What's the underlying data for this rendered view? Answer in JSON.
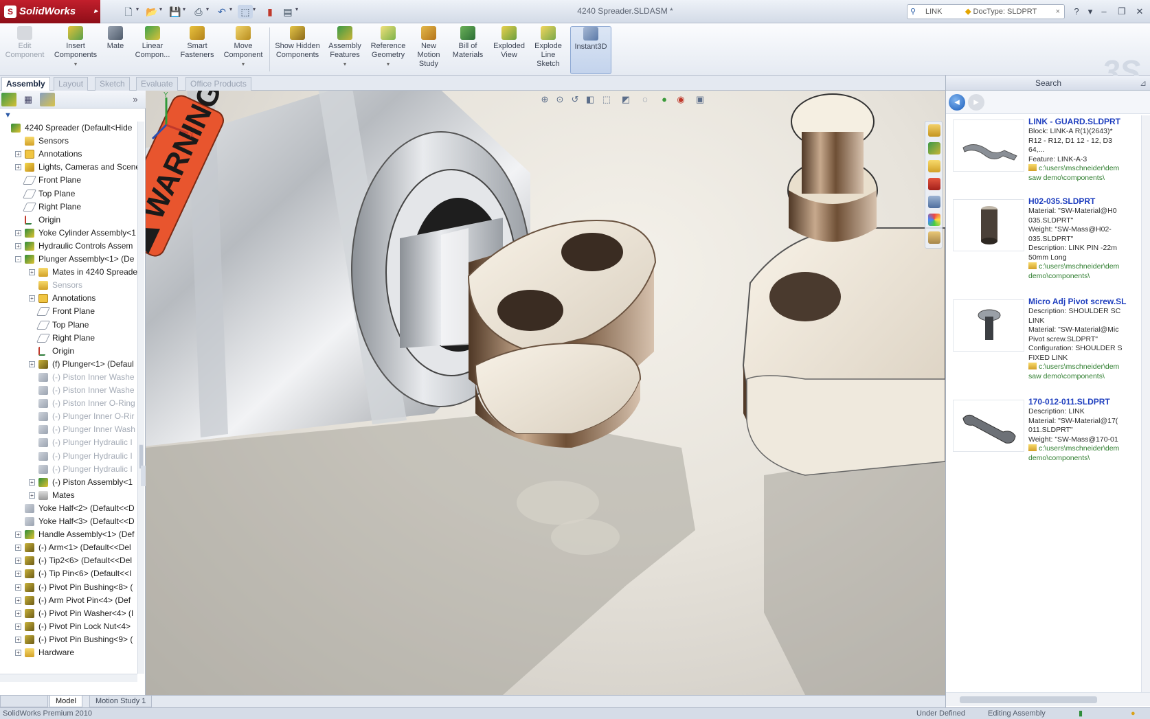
{
  "app": {
    "name": "SolidWorks",
    "document_title": "4240 Spreader.SLDASM *"
  },
  "search_box": {
    "term": "LINK",
    "filter": "DocType: SLDPRT"
  },
  "ribbon": [
    {
      "label": "Edit Component",
      "disabled": true
    },
    {
      "label": "Insert Components"
    },
    {
      "label": "Mate"
    },
    {
      "label": "Linear Compon..."
    },
    {
      "label": "Smart Fasteners"
    },
    {
      "label": "Move Component"
    },
    {
      "label": "Show Hidden Components"
    },
    {
      "label": "Assembly Features"
    },
    {
      "label": "Reference Geometry"
    },
    {
      "label": "New Motion Study"
    },
    {
      "label": "Bill of Materials"
    },
    {
      "label": "Exploded View"
    },
    {
      "label": "Explode Line Sketch"
    },
    {
      "label": "Instant3D",
      "active": true
    }
  ],
  "command_tabs": [
    "Assembly",
    "Layout",
    "Sketch",
    "Evaluate",
    "Office Products"
  ],
  "tree": [
    {
      "text": "4240 Spreader  (Default<Hide",
      "level": 0,
      "icon": "asm"
    },
    {
      "text": "Sensors",
      "level": 1,
      "icon": "folder"
    },
    {
      "text": "Annotations",
      "level": 1,
      "icon": "annot",
      "exp": "+"
    },
    {
      "text": "Lights, Cameras and Scene",
      "level": 1,
      "icon": "lights",
      "exp": "+"
    },
    {
      "text": "Front Plane",
      "level": 1,
      "icon": "plane"
    },
    {
      "text": "Top Plane",
      "level": 1,
      "icon": "plane"
    },
    {
      "text": "Right Plane",
      "level": 1,
      "icon": "plane"
    },
    {
      "text": "Origin",
      "level": 1,
      "icon": "origin"
    },
    {
      "text": "Yoke Cylinder Assembly<1",
      "level": 1,
      "icon": "asm",
      "exp": "+"
    },
    {
      "text": "Hydraulic Controls Assem",
      "level": 1,
      "icon": "asm",
      "exp": "+"
    },
    {
      "text": "Plunger Assembly<1> (De",
      "level": 1,
      "icon": "asm",
      "exp": "-"
    },
    {
      "text": "Mates in 4240 Spreade",
      "level": 2,
      "icon": "folder",
      "exp": "+"
    },
    {
      "text": "Sensors",
      "level": 2,
      "icon": "folder",
      "sup": true
    },
    {
      "text": "Annotations",
      "level": 2,
      "icon": "annot",
      "exp": "+"
    },
    {
      "text": "Front Plane",
      "level": 2,
      "icon": "plane"
    },
    {
      "text": "Top Plane",
      "level": 2,
      "icon": "plane"
    },
    {
      "text": "Right Plane",
      "level": 2,
      "icon": "plane"
    },
    {
      "text": "Origin",
      "level": 2,
      "icon": "origin"
    },
    {
      "text": "(f) Plunger<1> (Defaul",
      "level": 2,
      "icon": "part",
      "exp": "+"
    },
    {
      "text": "(-) Piston Inner Washe",
      "level": 2,
      "icon": "partg",
      "sup": true
    },
    {
      "text": "(-) Piston Inner Washe",
      "level": 2,
      "icon": "partg",
      "sup": true
    },
    {
      "text": "(-) Piston Inner O-Ring",
      "level": 2,
      "icon": "partg",
      "sup": true
    },
    {
      "text": "(-) Plunger Inner O-Rir",
      "level": 2,
      "icon": "partg",
      "sup": true
    },
    {
      "text": "(-) Plunger Inner Wash",
      "level": 2,
      "icon": "partg",
      "sup": true
    },
    {
      "text": "(-) Plunger Hydraulic I",
      "level": 2,
      "icon": "partg",
      "sup": true
    },
    {
      "text": "(-) Plunger Hydraulic I",
      "level": 2,
      "icon": "partg",
      "sup": true
    },
    {
      "text": "(-) Plunger Hydraulic I",
      "level": 2,
      "icon": "partg",
      "sup": true
    },
    {
      "text": "(-) Piston Assembly<1",
      "level": 2,
      "icon": "asm",
      "exp": "+"
    },
    {
      "text": "Mates",
      "level": 2,
      "icon": "mates",
      "exp": "+"
    },
    {
      "text": "Yoke Half<2> (Default<<D",
      "level": 1,
      "icon": "partg"
    },
    {
      "text": "Yoke Half<3> (Default<<D",
      "level": 1,
      "icon": "partg"
    },
    {
      "text": "Handle Assembly<1> (Def",
      "level": 1,
      "icon": "asm",
      "exp": "+"
    },
    {
      "text": "(-) Arm<1> (Default<<Del",
      "level": 1,
      "icon": "part",
      "exp": "+"
    },
    {
      "text": "(-) Tip2<6> (Default<<Del",
      "level": 1,
      "icon": "part",
      "exp": "+"
    },
    {
      "text": "(-) Tip Pin<6> (Default<<I",
      "level": 1,
      "icon": "part",
      "exp": "+"
    },
    {
      "text": "(-) Pivot Pin Bushing<8> (",
      "level": 1,
      "icon": "part",
      "exp": "+"
    },
    {
      "text": "(-) Arm Pivot Pin<4> (Def",
      "level": 1,
      "icon": "part",
      "exp": "+"
    },
    {
      "text": "(-) Pivot Pin Washer<4> (I",
      "level": 1,
      "icon": "part",
      "exp": "+"
    },
    {
      "text": "(-) Pivot Pin Lock Nut<4>",
      "level": 1,
      "icon": "part",
      "exp": "+"
    },
    {
      "text": "(-) Pivot Pin Bushing<9> (",
      "level": 1,
      "icon": "part",
      "exp": "+"
    },
    {
      "text": "Hardware",
      "level": 1,
      "icon": "folder",
      "exp": "+"
    }
  ],
  "bottom_tabs": [
    "Model",
    "Motion Study 1"
  ],
  "status": {
    "product": "SolidWorks Premium 2010",
    "state": "Under Defined",
    "mode": "Editing Assembly"
  },
  "viewport": {
    "decal_text": "WARNING",
    "colors": {
      "decal": "#e8552e",
      "steel": "#b9bcc0",
      "background": "#ece8e1"
    }
  },
  "task_pane": {
    "title": "Search",
    "results": [
      {
        "title": "LINK - GUARD.SLDPRT",
        "lines": [
          "Block: LINK-A R(1)(2643)*",
          "R12 - R12, D1 12 - 12, D3",
          "64,...",
          "Feature: LINK-A-3"
        ],
        "path": [
          "c:\\users\\mschneider\\dem",
          "saw demo\\components\\"
        ]
      },
      {
        "title": "H02-035.SLDPRT",
        "lines": [
          "Material: \"SW-Material@H0",
          "035.SLDPRT\"",
          "Weight: \"SW-Mass@H02-",
          "035.SLDPRT\"",
          "Description: LINK PIN -22m",
          "50mm Long"
        ],
        "path": [
          "c:\\users\\mschneider\\dem",
          "demo\\components\\"
        ]
      },
      {
        "title": "Micro Adj Pivot screw.SL",
        "lines": [
          "Description: SHOULDER SC",
          "LINK",
          "Material: \"SW-Material@Mic",
          "Pivot screw.SLDPRT\"",
          "Configuration: SHOULDER S",
          "FIXED LINK"
        ],
        "path": [
          "c:\\users\\mschneider\\dem",
          "saw demo\\components\\"
        ]
      },
      {
        "title": "170-012-011.SLDPRT",
        "lines": [
          "Description: LINK",
          "Material: \"SW-Material@17(",
          "011.SLDPRT\"",
          "Weight: \"SW-Mass@170-01"
        ],
        "path": [
          "c:\\users\\mschneider\\dem",
          "demo\\components\\"
        ]
      }
    ]
  }
}
